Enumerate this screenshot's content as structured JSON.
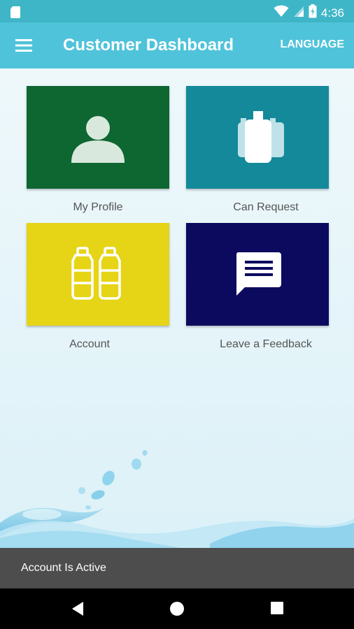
{
  "status_bar": {
    "time": "4:36"
  },
  "app_bar": {
    "title": "Customer Dashboard",
    "language_label": "LANGUAGE"
  },
  "tiles": [
    {
      "label": "My Profile",
      "color": "#0e6631",
      "icon": "person-icon"
    },
    {
      "label": "Can Request",
      "color": "#14899a",
      "icon": "water-cans-icon"
    },
    {
      "label": "Account",
      "color": "#e6d416",
      "icon": "bottles-icon"
    },
    {
      "label": "Leave a Feedback",
      "color": "#0c0a5e",
      "icon": "feedback-message-icon"
    }
  ],
  "snackbar": {
    "message": "Account Is Active"
  },
  "colors": {
    "primary": "#4fc3da",
    "status_bar": "#3fb6c8",
    "snackbar": "#4d4d4d"
  }
}
